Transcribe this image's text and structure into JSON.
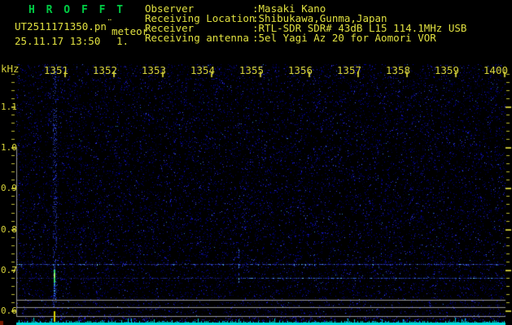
{
  "app": {
    "name": "HROFFT",
    "title": "H R O F F T"
  },
  "header": {
    "filename": "UT2511171350.pn",
    "filename_artifact": "¨",
    "observation_name": "meteor",
    "datetime": "25.11.17 13:50",
    "frame_counter": "1.",
    "info": [
      {
        "id": "observer",
        "label": "Observer",
        "value": ":Masaki Kano"
      },
      {
        "id": "receiving-location",
        "label": "Receiving Location",
        "value": ":Shibukawa,Gunma,Japan"
      },
      {
        "id": "receiver",
        "label": "Receiver",
        "value": ":RTL-SDR SDR# 43dB L15 114.1MHz USB"
      },
      {
        "id": "receiving-antenna",
        "label": "Receiving antenna",
        "value": ":5el Yagi Az 20 for Aomori VOR"
      }
    ]
  },
  "chart_data": {
    "type": "heatmap",
    "subtype": "radio-meteor-spectrogram",
    "x_axis": {
      "unit": "UT time HHMM",
      "start": "1350",
      "end": "1400",
      "ticks": [
        "1351",
        "1352",
        "1353",
        "1354",
        "1355",
        "1356",
        "1357",
        "1358",
        "1359",
        "1400"
      ]
    },
    "y_axis": {
      "label": "kHz",
      "range_khz": [
        0.6,
        1.2
      ],
      "ticks": [
        "1.1",
        "1.0",
        "0.9",
        "0.8",
        "0.7",
        "0.6"
      ],
      "minor_step_khz": 0.02
    },
    "features": {
      "carrier_lines_khz": [
        0.713,
        0.679
      ],
      "reference_lines_khz": [
        0.626,
        0.608,
        0.586
      ],
      "meteor_events": [
        {
          "time_ut": "13:50:47",
          "freq_khz_low": 0.67,
          "freq_khz_high": 0.71,
          "strength": "strong",
          "detection_marker": true
        },
        {
          "time_ut": "13:54:33",
          "freq_khz_low": 0.67,
          "freq_khz_high": 0.75,
          "strength": "faint",
          "detection_marker": false
        }
      ],
      "signal_level_graph": "cyan bar graph along bottom edge"
    }
  },
  "colors": {
    "background": "#000000",
    "title_green": "#00cc44",
    "text_yellow": "#e0e040",
    "tick_yellow": "#c0bc34",
    "grid_gray": "#989898",
    "noise_blue": [
      "#00004e",
      "#0000a0",
      "#1616cc",
      "#3333ee",
      "#4466ff"
    ],
    "carrier_dim": "#1c1c78",
    "carrier_mid": "#2f4fd0",
    "carrier_bright": "#70d8ff",
    "echo_green": "#38d868",
    "echo_core": "#8af070",
    "bargraph_cyan": "#00dede",
    "event_marker_yellow": "#d8d400",
    "corner_red": "#781800"
  }
}
